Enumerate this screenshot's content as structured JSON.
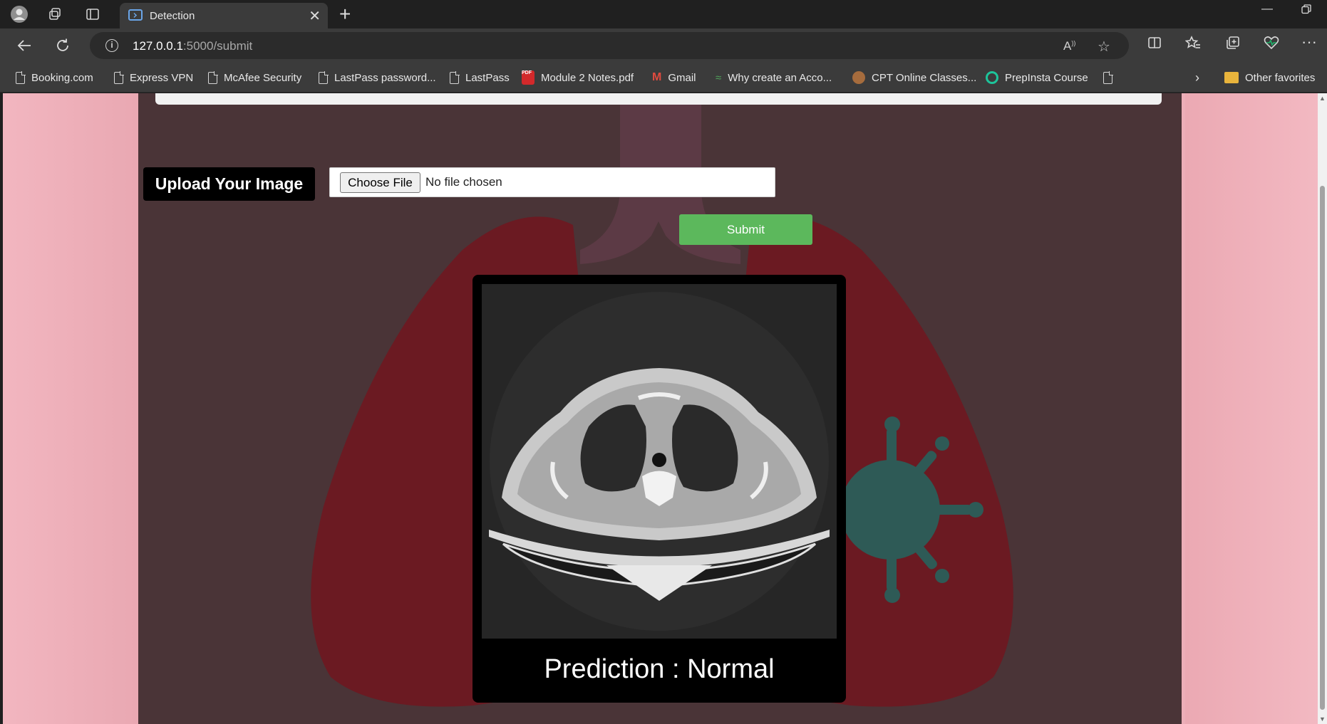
{
  "browser": {
    "tab_title": "Detection",
    "tab_close": "✕",
    "new_tab": "+",
    "url_host": "127.0.0.1",
    "url_path": ":5000/submit",
    "bookmarks": [
      {
        "label": "Booking.com",
        "icon": "page-icon"
      },
      {
        "label": "Express VPN",
        "icon": "page-icon"
      },
      {
        "label": "McAfee Security",
        "icon": "page-icon"
      },
      {
        "label": "LastPass password...",
        "icon": "page-icon"
      },
      {
        "label": "LastPass",
        "icon": "page-icon"
      },
      {
        "label": "Module 2 Notes.pdf",
        "icon": "pdf-icon"
      },
      {
        "label": "Gmail",
        "icon": "gmail-icon"
      },
      {
        "label": "Why create an Acco...",
        "icon": "leaf-icon"
      },
      {
        "label": "CPT Online Classes...",
        "icon": "cat-icon"
      },
      {
        "label": "PrepInsta Course",
        "icon": "prepinsta-icon"
      }
    ],
    "other_favorites": "Other favorites"
  },
  "page": {
    "upload_label": "Upload Your Image",
    "choose_file": "Choose File",
    "file_status": "No file chosen",
    "submit": "Submit",
    "prediction": "Prediction : Normal"
  },
  "colors": {
    "submit_green": "#5cb85c",
    "page_bg_pink": "#ecaeb8",
    "content_bg": "#4a3437"
  }
}
